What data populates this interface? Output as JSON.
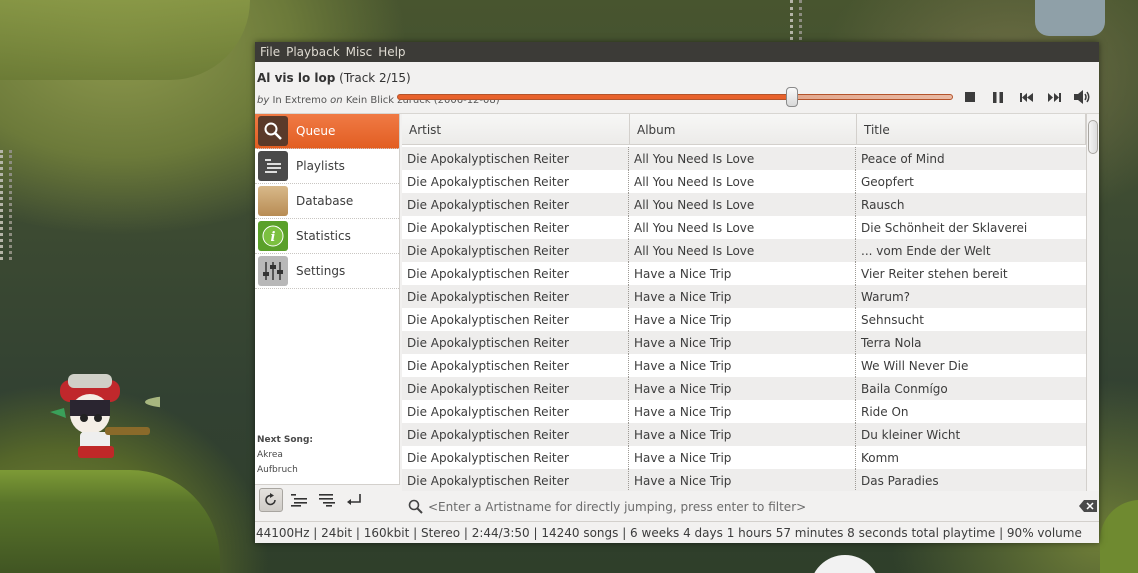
{
  "menu": [
    "File",
    "Playback",
    "Misc",
    "Help"
  ],
  "now_playing": {
    "title": "Al vis lo lop",
    "track_info": "(Track 2/15)",
    "by_word": "by",
    "artist": "In Extremo",
    "on_word": "on",
    "album": "Kein Blick zurück",
    "date": "(2006-12-08)",
    "progress_fraction": 0.71
  },
  "controls": {
    "stop": "stop-icon",
    "pause": "pause-icon",
    "prev": "previous-icon",
    "next": "next-icon",
    "volume": "volume-icon"
  },
  "sidebar": {
    "items": [
      {
        "label": "Queue",
        "icon": "search-icon",
        "active": true
      },
      {
        "label": "Playlists",
        "icon": "playlist-icon",
        "active": false
      },
      {
        "label": "Database",
        "icon": "folder-icon",
        "active": false
      },
      {
        "label": "Statistics",
        "icon": "info-icon",
        "active": false
      },
      {
        "label": "Settings",
        "icon": "sliders-icon",
        "active": false
      }
    ],
    "next_song": {
      "heading": "Next Song:",
      "artist": "Akrea",
      "title": "Aufbruch"
    }
  },
  "table": {
    "columns": [
      "Artist",
      "Album",
      "Title"
    ],
    "rows": [
      [
        "Die Apokalyptischen Reiter",
        "All You Need Is Love",
        "Peace of Mind"
      ],
      [
        "Die Apokalyptischen Reiter",
        "All You Need Is Love",
        "Geopfert"
      ],
      [
        "Die Apokalyptischen Reiter",
        "All You Need Is Love",
        "Rausch"
      ],
      [
        "Die Apokalyptischen Reiter",
        "All You Need Is Love",
        "Die Schönheit der Sklaverei"
      ],
      [
        "Die Apokalyptischen Reiter",
        "All You Need Is Love",
        "... vom Ende der Welt"
      ],
      [
        "Die Apokalyptischen Reiter",
        "Have a Nice Trip",
        "Vier Reiter stehen bereit"
      ],
      [
        "Die Apokalyptischen Reiter",
        "Have a Nice Trip",
        "Warum?"
      ],
      [
        "Die Apokalyptischen Reiter",
        "Have a Nice Trip",
        "Sehnsucht"
      ],
      [
        "Die Apokalyptischen Reiter",
        "Have a Nice Trip",
        "Terra Nola"
      ],
      [
        "Die Apokalyptischen Reiter",
        "Have a Nice Trip",
        "We Will Never Die"
      ],
      [
        "Die Apokalyptischen Reiter",
        "Have a Nice Trip",
        "Baila Conmígo"
      ],
      [
        "Die Apokalyptischen Reiter",
        "Have a Nice Trip",
        "Ride On"
      ],
      [
        "Die Apokalyptischen Reiter",
        "Have a Nice Trip",
        "Du kleiner Wicht"
      ],
      [
        "Die Apokalyptischen Reiter",
        "Have a Nice Trip",
        "Komm"
      ],
      [
        "Die Apokalyptischen Reiter",
        "Have a Nice Trip",
        "Das Paradies"
      ]
    ]
  },
  "filter": {
    "placeholder": "<Enter a Artistname for directly jumping, press enter to filter>"
  },
  "status": "44100Hz | 24bit | 160kbit | Stereo | 2:44/3:50 | 14240 songs | 6 weeks 4 days 1 hours 57 minutes 8 seconds total playtime | 90% volume",
  "colors": {
    "accent": "#e8622c",
    "menubar": "#3c3b37"
  }
}
